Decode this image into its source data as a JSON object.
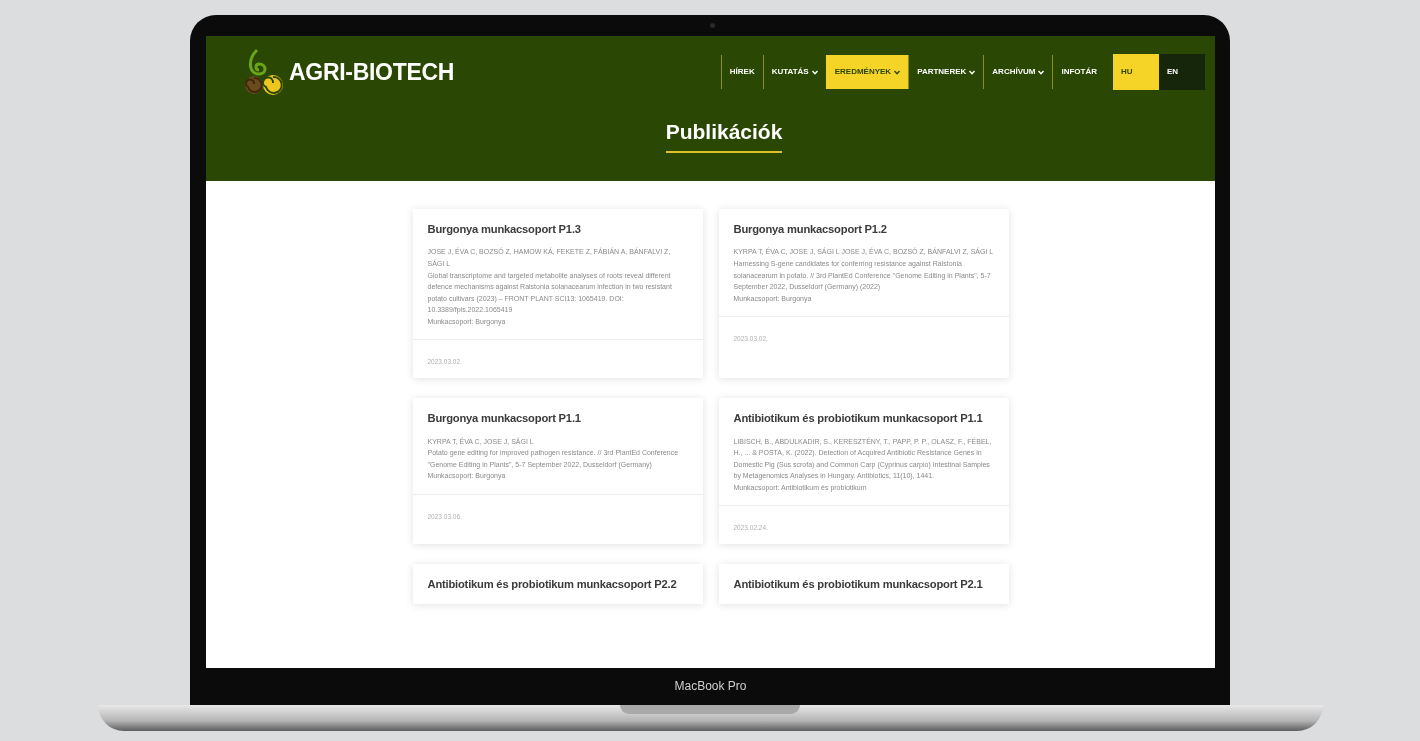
{
  "device": {
    "label": "MacBook Pro"
  },
  "site": {
    "logo_text": "AGRI-BIOTECH"
  },
  "nav": [
    {
      "label": "HÍREK",
      "kind": "link",
      "selected": false
    },
    {
      "label": "KUTATÁS",
      "kind": "dropdown",
      "selected": false
    },
    {
      "label": "EREDMÉNYEK",
      "kind": "dropdown",
      "selected": true
    },
    {
      "label": "PARTNEREK",
      "kind": "dropdown",
      "selected": false
    },
    {
      "label": "ARCHÍVUM",
      "kind": "dropdown",
      "selected": false
    },
    {
      "label": "INFOTÁR",
      "kind": "link",
      "selected": false
    }
  ],
  "languages": [
    {
      "label": "HU",
      "selected": true
    },
    {
      "label": "EN",
      "selected": false
    }
  ],
  "page_title": "Publikációk",
  "cards": [
    {
      "title": "Burgonya munkacsoport P1.3",
      "lines": [
        "JOSE J, ÉVA C, BOZSÓ Z, HAMOW KÁ, FEKETE Z, FÁBIÁN A, BÁNFALVI Z, SÁGI L",
        "Global transcriptome and targeted metabolite analyses of roots reveal different defence mechanisms against Ralstonia solanacearum infection in two resistant potato cultivars (2023) – FRONT PLANT SCI13: 1065419. DOI: 10.3389/fpls.2022.1065419",
        "Munkacsoport: Burgonya"
      ],
      "date": "2023.03.02."
    },
    {
      "title": "Burgonya munkacsoport P1.2",
      "lines": [
        "KYRPA T, ÉVA C, JOSE J, SÁGI L JOSE J, ÉVA C, BOZSÓ Z, BÁNFALVI Z, SÁGI L",
        "Harnessing S-gene candidates for conferring resistance against Ralstonia solanacearum in potato. // 3rd PlantEd Conference \"Genome Editing in Plants\", 5-7 September 2022, Dusseldorf (Germany) (2022)",
        "Munkacsoport: Burgonya"
      ],
      "date": "2023.03.02."
    },
    {
      "title": "Burgonya munkacsoport P1.1",
      "lines": [
        "KYRPA T, ÉVA C, JOSE J, SÁGI L",
        "Potato gene editing for improved pathogen resistance. // 3rd PlantEd Conference \"Genome Editing in Plants\", 5-7 September 2022, Dusseldorf (Germany)",
        "Munkacsoport: Burgonya"
      ],
      "date": "2023.03.06."
    },
    {
      "title": "Antibiotikum és probiotikum munkacsoport P1.1",
      "lines": [
        "LIBISCH, B., ABDULKADIR, S., KERESZTÉNY, T., PAPP, P. P., OLASZ, F., FÉBEL, H., ... & POSTA, K. (2022). Detection of Acquired Antibiotic Resistance Genes in Domestic Pig (Sus scrofa) and Common Carp (Cyprinus carpio) Intestinal Samples by Metagenomics Analyses in Hungary. Antibiotics, 11(10), 1441.",
        "Munkacsoport: Antibiotikum és probiotikum"
      ],
      "date": "2023.02.24."
    },
    {
      "title": "Antibiotikum és probiotikum munkacsoport P2.2"
    },
    {
      "title": "Antibiotikum és probiotikum munkacsoport P2.1"
    }
  ]
}
